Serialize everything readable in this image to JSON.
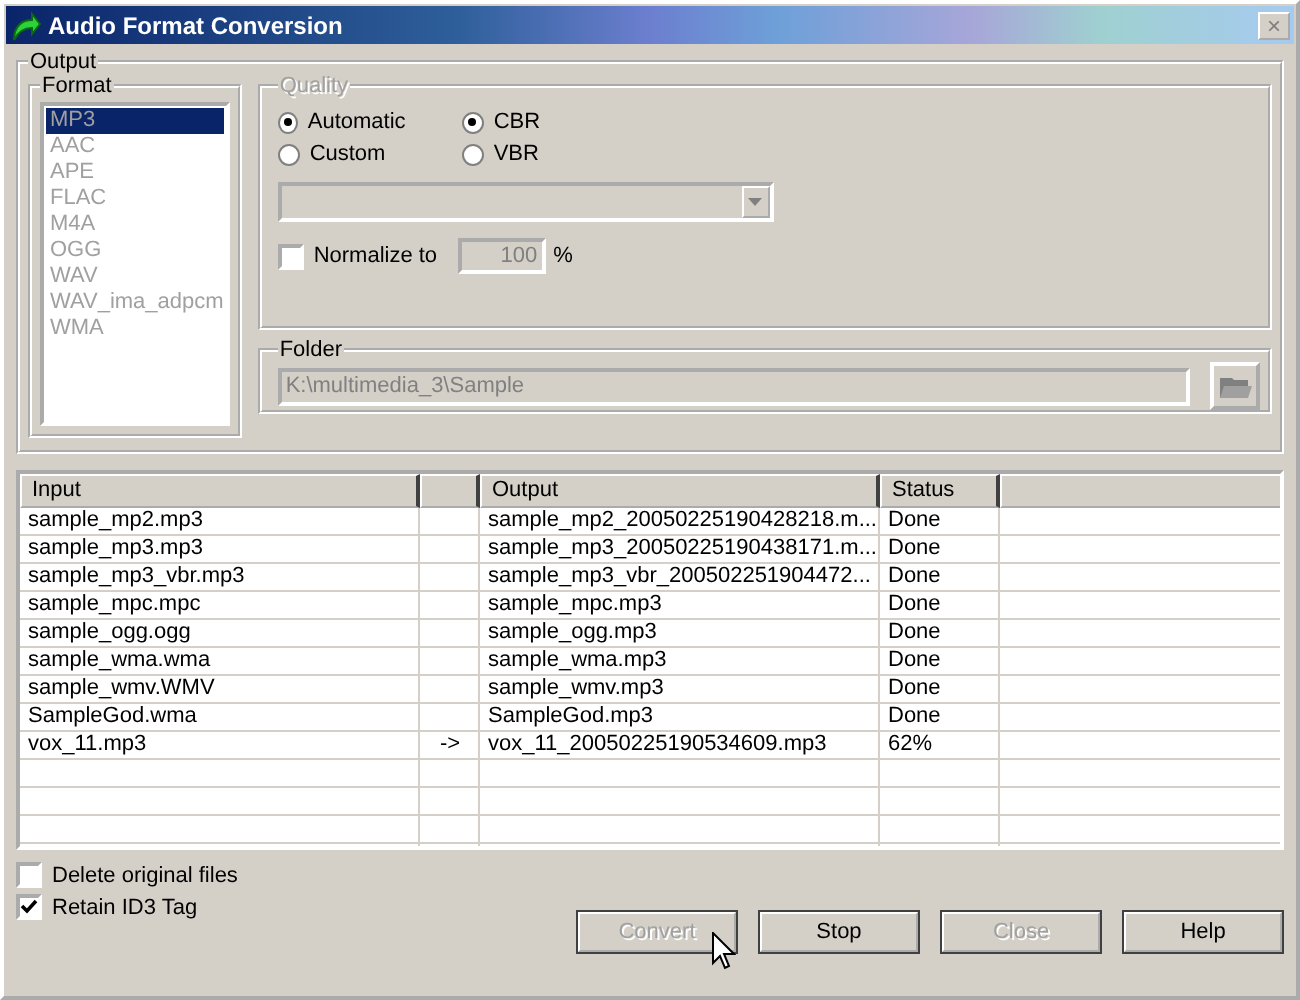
{
  "window": {
    "title": "Audio Format Conversion",
    "close": "×"
  },
  "output": {
    "title": "Output",
    "format": {
      "title": "Format",
      "items": [
        {
          "label": "MP3",
          "selected": true
        },
        {
          "label": "AAC",
          "selected": false
        },
        {
          "label": "APE",
          "selected": false
        },
        {
          "label": "FLAC",
          "selected": false
        },
        {
          "label": "M4A",
          "selected": false
        },
        {
          "label": "OGG",
          "selected": false
        },
        {
          "label": "WAV",
          "selected": false
        },
        {
          "label": "WAV_ima_adpcm",
          "selected": false
        },
        {
          "label": "WMA",
          "selected": false
        }
      ]
    },
    "quality": {
      "title": "Quality",
      "disabled": true,
      "mode": [
        {
          "label": "Automatic",
          "selected": true
        },
        {
          "label": "Custom",
          "selected": false
        }
      ],
      "bitrate": [
        {
          "label": "CBR",
          "selected": true
        },
        {
          "label": "VBR",
          "selected": false
        }
      ],
      "normalize": {
        "label": "Normalize to",
        "checked": false,
        "value": "100",
        "unit": "%"
      }
    },
    "folder": {
      "title": "Folder",
      "value": "K:\\multimedia_3\\Sample"
    }
  },
  "table": {
    "columns": [
      "Input",
      "Output",
      "Status"
    ],
    "rows": [
      {
        "input": "sample_mp2.mp3",
        "output": "sample_mp2_20050225190428218.m...",
        "status": "Done"
      },
      {
        "input": "sample_mp3.mp3",
        "output": "sample_mp3_20050225190438171.m...",
        "status": "Done"
      },
      {
        "input": "sample_mp3_vbr.mp3",
        "output": "sample_mp3_vbr_200502251904472...",
        "status": "Done"
      },
      {
        "input": "sample_mpc.mpc",
        "output": "sample_mpc.mp3",
        "status": "Done"
      },
      {
        "input": "sample_ogg.ogg",
        "output": "sample_ogg.mp3",
        "status": "Done"
      },
      {
        "input": "sample_wma.wma",
        "output": "sample_wma.mp3",
        "status": "Done"
      },
      {
        "input": "sample_wmv.WMV",
        "output": "sample_wmv.mp3",
        "status": "Done"
      },
      {
        "input": "SampleGod.wma",
        "output": "SampleGod.mp3",
        "status": "Done"
      },
      {
        "input": "vox_11.mp3",
        "arrow": "->",
        "output": "vox_11_20050225190534609.mp3",
        "status": "62%"
      }
    ]
  },
  "options": [
    {
      "label": "Delete original files",
      "checked": false
    },
    {
      "label": "Retain ID3 Tag",
      "checked": true
    }
  ],
  "buttons": [
    {
      "label": "Convert",
      "disabled": true
    },
    {
      "label": "Stop",
      "disabled": false
    },
    {
      "label": "Close",
      "disabled": true
    },
    {
      "label": "Help",
      "disabled": false
    }
  ]
}
